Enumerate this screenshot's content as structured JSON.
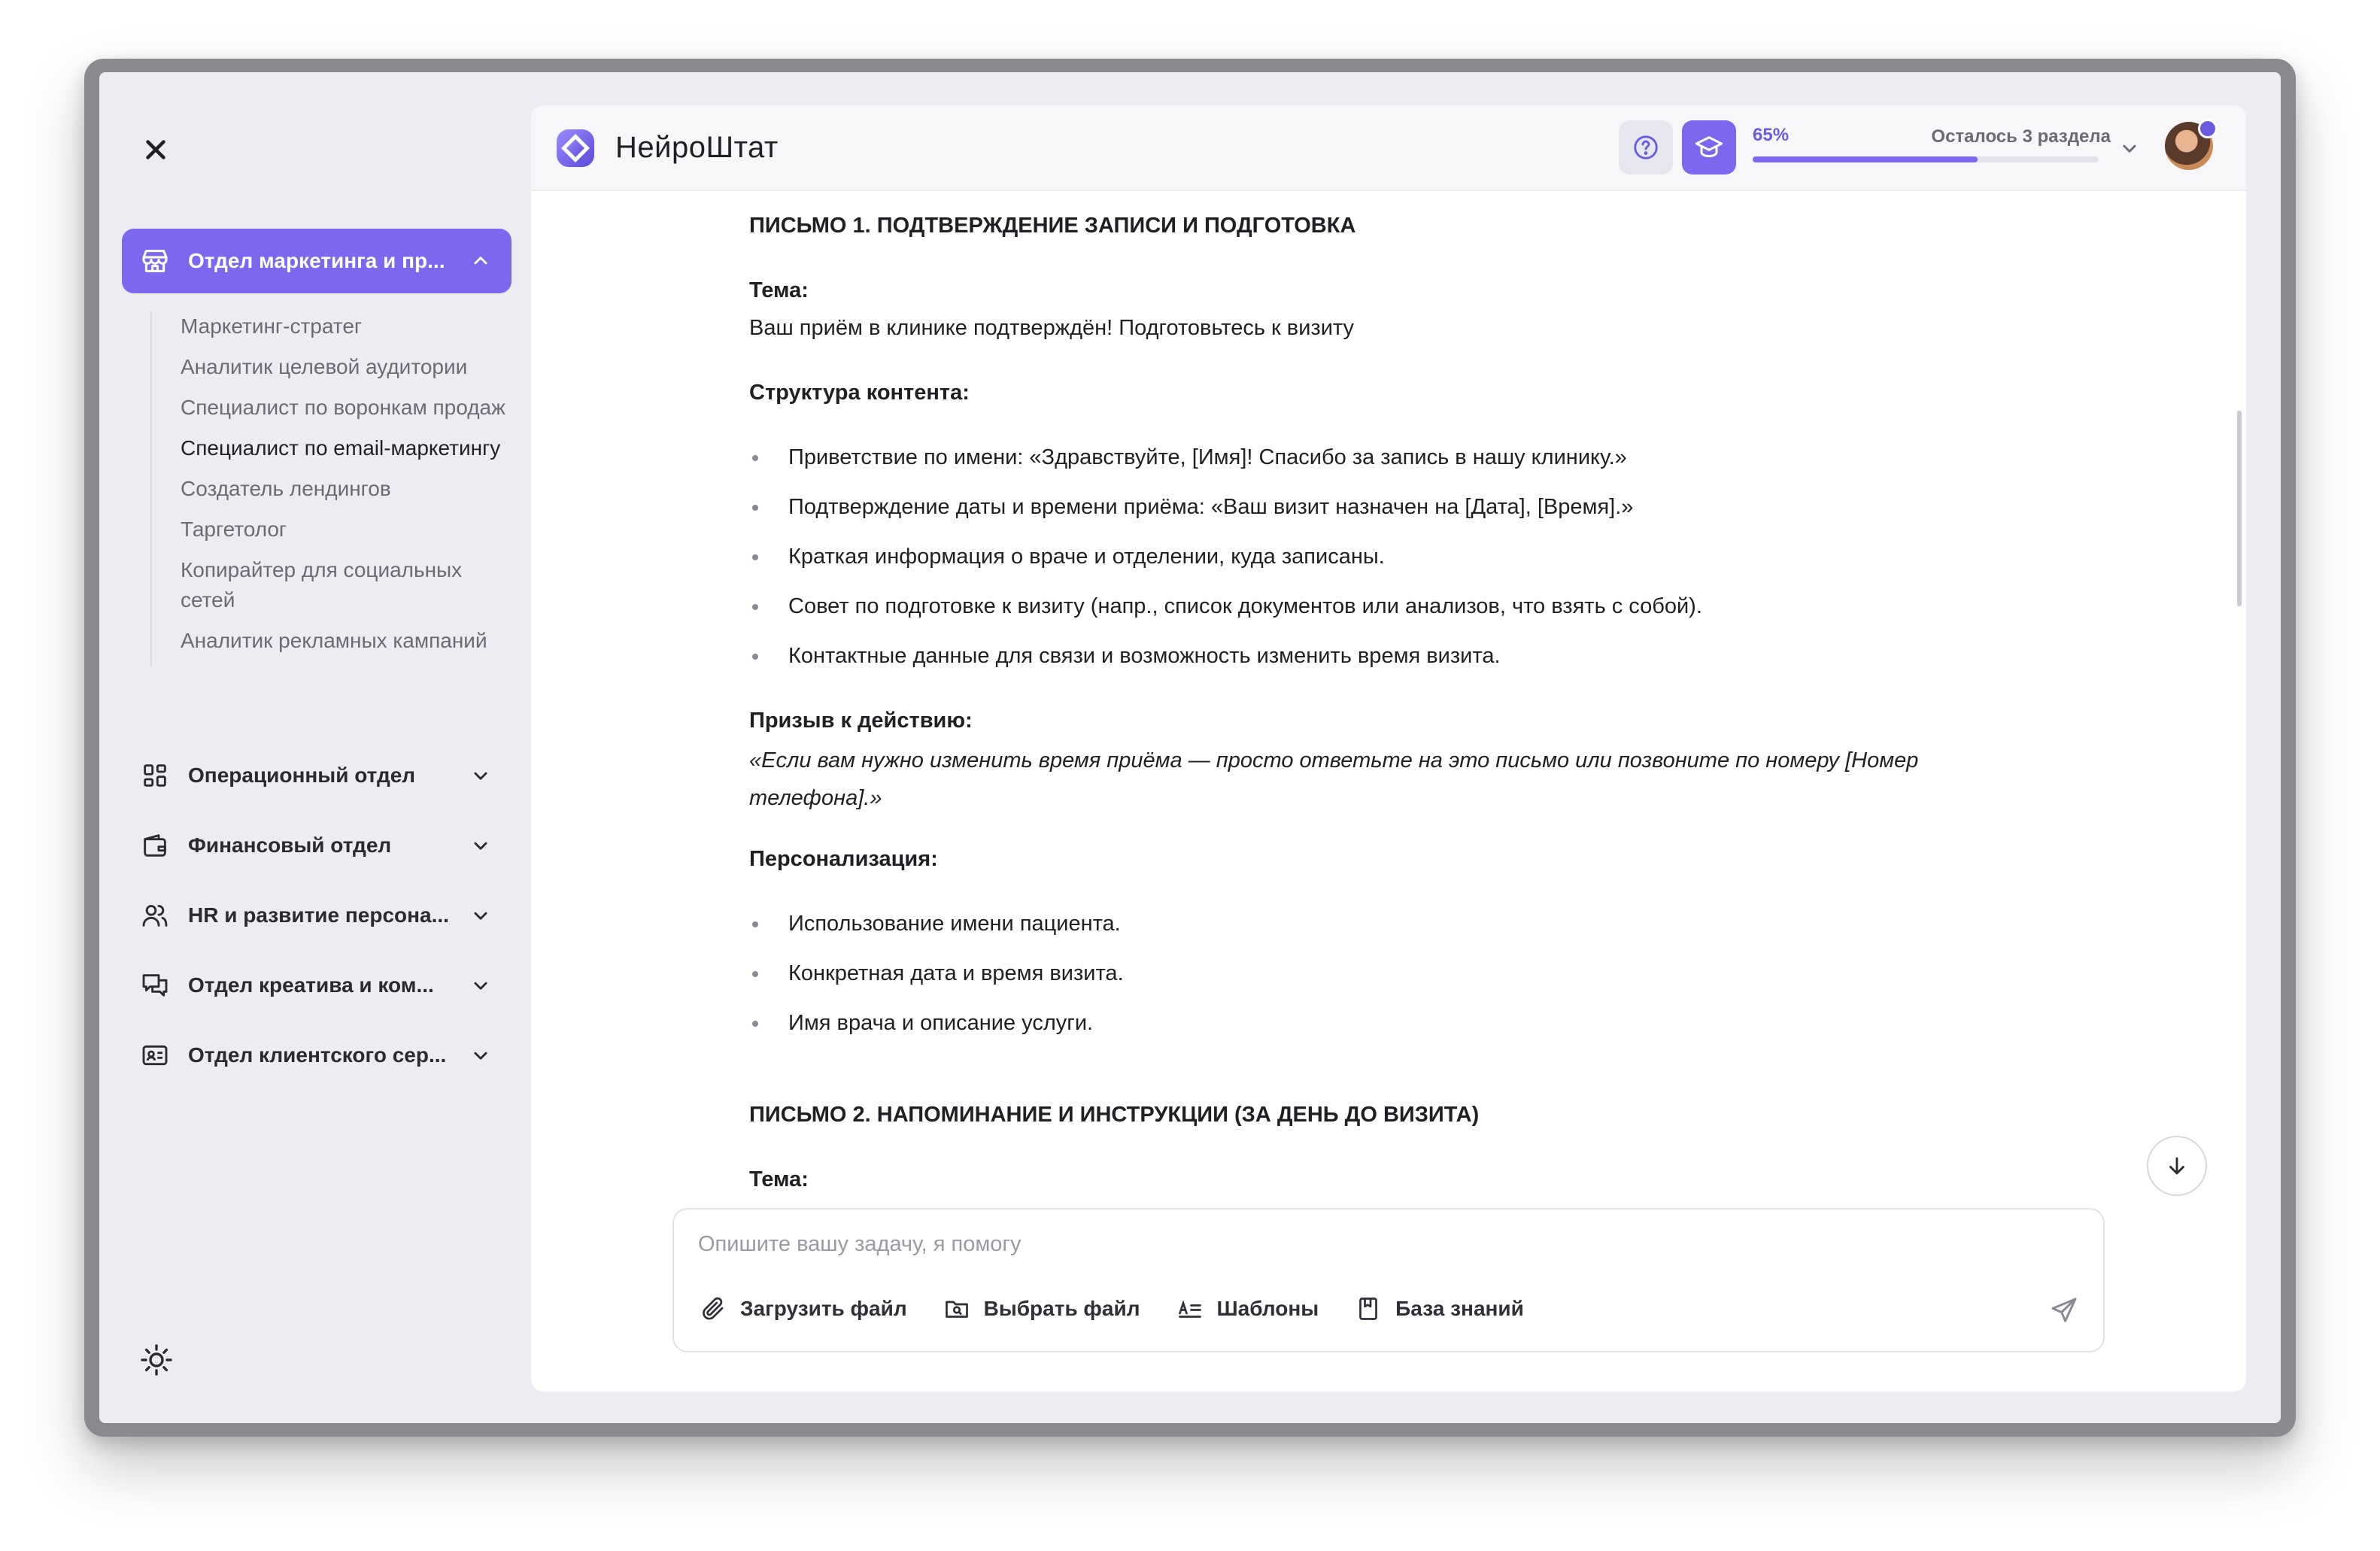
{
  "app": {
    "brand": "НейроШтат"
  },
  "sidebar": {
    "active_department": {
      "label": "Отдел маркетинга и пр...",
      "icon": "store-icon",
      "items": [
        {
          "label": "Маркетинг-стратег",
          "active": false
        },
        {
          "label": "Аналитик целевой аудитории",
          "active": false
        },
        {
          "label": "Специалист по воронкам продаж",
          "active": false
        },
        {
          "label": "Специалист по email-маркетингу",
          "active": true
        },
        {
          "label": "Создатель лендингов",
          "active": false
        },
        {
          "label": "Таргетолог",
          "active": false
        },
        {
          "label": "Копирайтер для социальных сетей",
          "active": false
        },
        {
          "label": "Аналитик рекламных кампаний",
          "active": false
        }
      ]
    },
    "departments": [
      {
        "label": "Операционный отдел",
        "icon": "grid-icon"
      },
      {
        "label": "Финансовый отдел",
        "icon": "wallet-icon"
      },
      {
        "label": "HR и развитие персона...",
        "icon": "users-icon"
      },
      {
        "label": "Отдел креатива и ком...",
        "icon": "chat-icon"
      },
      {
        "label": "Отдел клиентского сер...",
        "icon": "id-card-icon"
      }
    ]
  },
  "header": {
    "progress_percent": "65%",
    "progress_value": 0.65,
    "remaining_label": "Осталось 3 раздела"
  },
  "content": {
    "letter1_title": "ПИСЬМО 1. ПОДТВЕРЖДЕНИЕ ЗАПИСИ И ПОДГОТОВКА",
    "subject_label": "Тема:",
    "subject_text": "Ваш приём в клинике подтверждён! Подготовьтесь к визиту",
    "structure_label": "Структура контента:",
    "structure_items": [
      "Приветствие по имени: «Здравствуйте, [Имя]! Спасибо за запись в нашу клинику.»",
      "Подтверждение даты и времени приёма: «Ваш визит назначен на [Дата], [Время].»",
      "Краткая информация о враче и отделении, куда записаны.",
      "Совет по подготовке к визиту (напр., список документов или анализов, что взять с собой).",
      "Контактные данные для связи и возможность изменить время визита."
    ],
    "cta_label": "Призыв к действию:",
    "cta_text": "«Если вам нужно изменить время приёма — просто ответьте на это письмо или позвоните по номеру [Номер телефона].»",
    "personalization_label": "Персонализация:",
    "personalization_items": [
      "Использование имени пациента.",
      "Конкретная дата и время визита.",
      "Имя врача и описание услуги."
    ],
    "letter2_title": "ПИСЬМО 2. НАПОМИНАНИЕ И ИНСТРУКЦИИ (ЗА ДЕНЬ ДО ВИЗИТА)",
    "letter2_subject_label": "Тема:"
  },
  "composer": {
    "placeholder": "Опишите вашу задачу, я помогу",
    "value": "",
    "tools": [
      {
        "label": "Загрузить файл",
        "icon": "paperclip-icon"
      },
      {
        "label": "Выбрать файл",
        "icon": "folder-search-icon"
      },
      {
        "label": "Шаблоны",
        "icon": "text-list-icon"
      },
      {
        "label": "База знаний",
        "icon": "book-icon"
      }
    ]
  },
  "colors": {
    "accent": "#7b68ee",
    "accent_text": "#6a5ae0",
    "sidebar_bg": "#ececf2"
  }
}
